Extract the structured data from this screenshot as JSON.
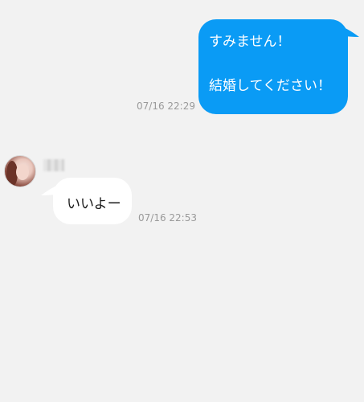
{
  "conversation": {
    "outgoing": {
      "line1": "すみません！",
      "line2": "結婚してください！",
      "timestamp": "07/16 22:29"
    },
    "incoming": {
      "text": "いいよー",
      "timestamp": "07/16 22:53"
    }
  },
  "colors": {
    "background": "#f2f2f2",
    "outgoing_bubble": "#0a9bf5",
    "incoming_bubble": "#ffffff",
    "timestamp": "#9a9a9a"
  }
}
